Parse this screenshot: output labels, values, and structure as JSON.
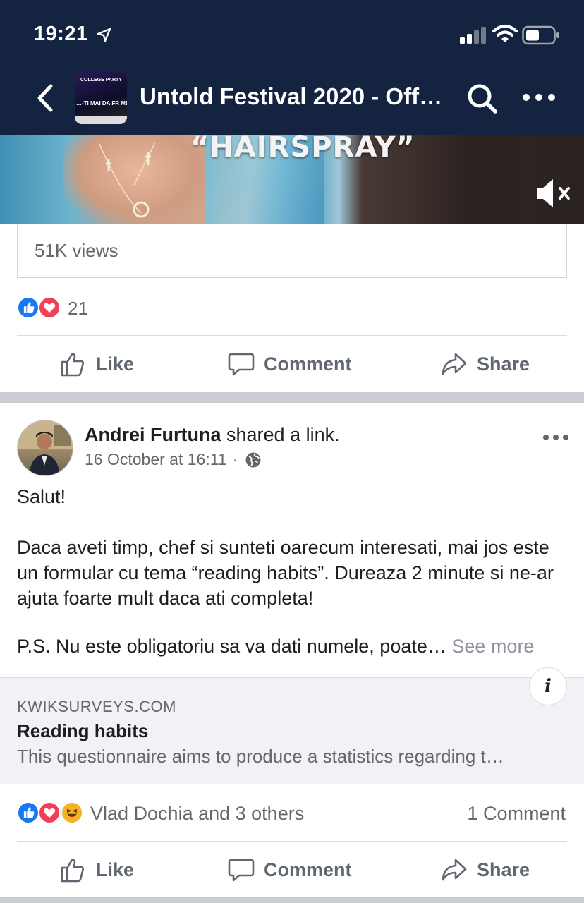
{
  "status_bar": {
    "time": "19:21"
  },
  "header": {
    "title": "Untold Festival 2020 - Off…",
    "avatar_text_top": "COLLEGE PARTY",
    "avatar_text_mid": "…-TI MAI DA FR ME"
  },
  "video": {
    "caption": "“HAIRSPRAY”",
    "views": "51K views"
  },
  "post1": {
    "reaction_count": "21",
    "actions": {
      "like": "Like",
      "comment": "Comment",
      "share": "Share"
    }
  },
  "post2": {
    "author": "Andrei Furtuna",
    "action_text": "shared a link.",
    "timestamp": "16 October at 16:11",
    "separator": "·",
    "body_greeting": "Salut!",
    "body_paragraph": "Daca aveti timp, chef si sunteti oarecum interesati, mai jos este un formular cu tema “reading habits”. Dureaza 2 minute si ne-ar ajuta foarte mult daca ati completa!",
    "body_ps": "P.S. Nu este obligatoriu sa va dati numele, poate…",
    "see_more": "See more",
    "link": {
      "domain": "KWIKSURVEYS.COM",
      "title": "Reading habits",
      "description": "This questionnaire aims to produce a statistics regarding t…",
      "info_icon_text": "i"
    },
    "reacted_by": "Vlad Dochia and 3 others",
    "comment_count": "1 Comment",
    "actions": {
      "like": "Like",
      "comment": "Comment",
      "share": "Share"
    }
  },
  "colors": {
    "header_bg": "#142440",
    "like_blue": "#1877f2",
    "love_red": "#f33e58",
    "haha_yellow": "#f7b125"
  }
}
